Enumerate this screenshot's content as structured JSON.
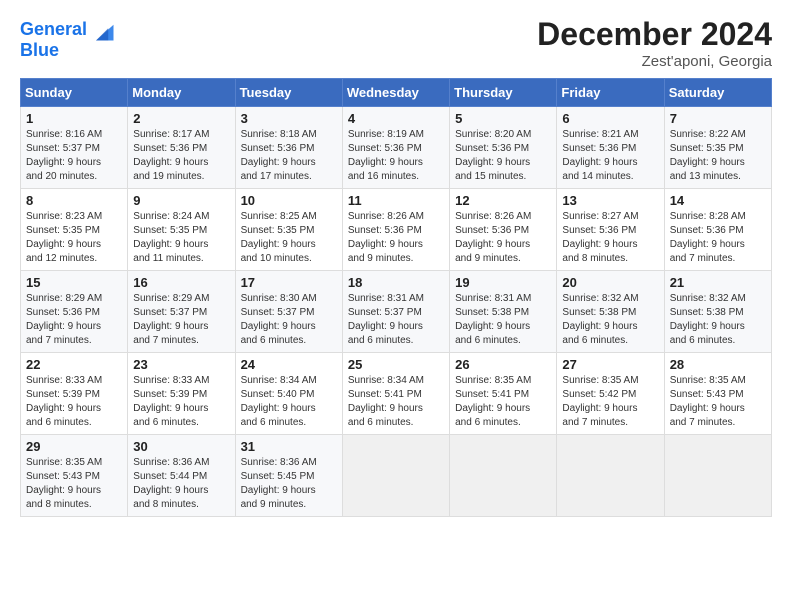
{
  "header": {
    "logo_line1": "General",
    "logo_line2": "Blue",
    "month_title": "December 2024",
    "location": "Zest'aponi, Georgia"
  },
  "days_of_week": [
    "Sunday",
    "Monday",
    "Tuesday",
    "Wednesday",
    "Thursday",
    "Friday",
    "Saturday"
  ],
  "weeks": [
    [
      {
        "day": 1,
        "info": "Sunrise: 8:16 AM\nSunset: 5:37 PM\nDaylight: 9 hours\nand 20 minutes."
      },
      {
        "day": 2,
        "info": "Sunrise: 8:17 AM\nSunset: 5:36 PM\nDaylight: 9 hours\nand 19 minutes."
      },
      {
        "day": 3,
        "info": "Sunrise: 8:18 AM\nSunset: 5:36 PM\nDaylight: 9 hours\nand 17 minutes."
      },
      {
        "day": 4,
        "info": "Sunrise: 8:19 AM\nSunset: 5:36 PM\nDaylight: 9 hours\nand 16 minutes."
      },
      {
        "day": 5,
        "info": "Sunrise: 8:20 AM\nSunset: 5:36 PM\nDaylight: 9 hours\nand 15 minutes."
      },
      {
        "day": 6,
        "info": "Sunrise: 8:21 AM\nSunset: 5:36 PM\nDaylight: 9 hours\nand 14 minutes."
      },
      {
        "day": 7,
        "info": "Sunrise: 8:22 AM\nSunset: 5:35 PM\nDaylight: 9 hours\nand 13 minutes."
      }
    ],
    [
      {
        "day": 8,
        "info": "Sunrise: 8:23 AM\nSunset: 5:35 PM\nDaylight: 9 hours\nand 12 minutes."
      },
      {
        "day": 9,
        "info": "Sunrise: 8:24 AM\nSunset: 5:35 PM\nDaylight: 9 hours\nand 11 minutes."
      },
      {
        "day": 10,
        "info": "Sunrise: 8:25 AM\nSunset: 5:35 PM\nDaylight: 9 hours\nand 10 minutes."
      },
      {
        "day": 11,
        "info": "Sunrise: 8:26 AM\nSunset: 5:36 PM\nDaylight: 9 hours\nand 9 minutes."
      },
      {
        "day": 12,
        "info": "Sunrise: 8:26 AM\nSunset: 5:36 PM\nDaylight: 9 hours\nand 9 minutes."
      },
      {
        "day": 13,
        "info": "Sunrise: 8:27 AM\nSunset: 5:36 PM\nDaylight: 9 hours\nand 8 minutes."
      },
      {
        "day": 14,
        "info": "Sunrise: 8:28 AM\nSunset: 5:36 PM\nDaylight: 9 hours\nand 7 minutes."
      }
    ],
    [
      {
        "day": 15,
        "info": "Sunrise: 8:29 AM\nSunset: 5:36 PM\nDaylight: 9 hours\nand 7 minutes."
      },
      {
        "day": 16,
        "info": "Sunrise: 8:29 AM\nSunset: 5:37 PM\nDaylight: 9 hours\nand 7 minutes."
      },
      {
        "day": 17,
        "info": "Sunrise: 8:30 AM\nSunset: 5:37 PM\nDaylight: 9 hours\nand 6 minutes."
      },
      {
        "day": 18,
        "info": "Sunrise: 8:31 AM\nSunset: 5:37 PM\nDaylight: 9 hours\nand 6 minutes."
      },
      {
        "day": 19,
        "info": "Sunrise: 8:31 AM\nSunset: 5:38 PM\nDaylight: 9 hours\nand 6 minutes."
      },
      {
        "day": 20,
        "info": "Sunrise: 8:32 AM\nSunset: 5:38 PM\nDaylight: 9 hours\nand 6 minutes."
      },
      {
        "day": 21,
        "info": "Sunrise: 8:32 AM\nSunset: 5:38 PM\nDaylight: 9 hours\nand 6 minutes."
      }
    ],
    [
      {
        "day": 22,
        "info": "Sunrise: 8:33 AM\nSunset: 5:39 PM\nDaylight: 9 hours\nand 6 minutes."
      },
      {
        "day": 23,
        "info": "Sunrise: 8:33 AM\nSunset: 5:39 PM\nDaylight: 9 hours\nand 6 minutes."
      },
      {
        "day": 24,
        "info": "Sunrise: 8:34 AM\nSunset: 5:40 PM\nDaylight: 9 hours\nand 6 minutes."
      },
      {
        "day": 25,
        "info": "Sunrise: 8:34 AM\nSunset: 5:41 PM\nDaylight: 9 hours\nand 6 minutes."
      },
      {
        "day": 26,
        "info": "Sunrise: 8:35 AM\nSunset: 5:41 PM\nDaylight: 9 hours\nand 6 minutes."
      },
      {
        "day": 27,
        "info": "Sunrise: 8:35 AM\nSunset: 5:42 PM\nDaylight: 9 hours\nand 7 minutes."
      },
      {
        "day": 28,
        "info": "Sunrise: 8:35 AM\nSunset: 5:43 PM\nDaylight: 9 hours\nand 7 minutes."
      }
    ],
    [
      {
        "day": 29,
        "info": "Sunrise: 8:35 AM\nSunset: 5:43 PM\nDaylight: 9 hours\nand 8 minutes."
      },
      {
        "day": 30,
        "info": "Sunrise: 8:36 AM\nSunset: 5:44 PM\nDaylight: 9 hours\nand 8 minutes."
      },
      {
        "day": 31,
        "info": "Sunrise: 8:36 AM\nSunset: 5:45 PM\nDaylight: 9 hours\nand 9 minutes."
      },
      null,
      null,
      null,
      null
    ]
  ]
}
